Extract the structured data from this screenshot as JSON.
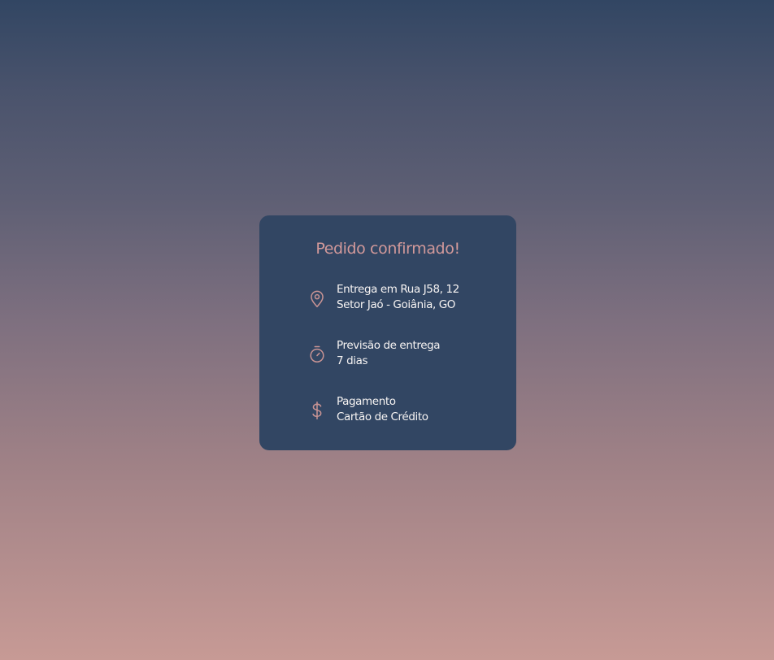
{
  "card": {
    "title": "Pedido confirmado!",
    "items": [
      {
        "icon": "map-pin-icon",
        "line1": "Entrega em Rua J58, 12",
        "line2": "Setor Jaó - Goiânia, GO"
      },
      {
        "icon": "timer-icon",
        "line1": "Previsão de entrega",
        "line2": "7 dias"
      },
      {
        "icon": "dollar-icon",
        "line1": "Pagamento",
        "line2": "Cartão de Crédito"
      }
    ]
  },
  "colors": {
    "card_background": "#324663",
    "accent": "#d2999a",
    "text": "#f7f4f3",
    "gradient_top": "#324663",
    "gradient_bottom": "#c79a95"
  }
}
